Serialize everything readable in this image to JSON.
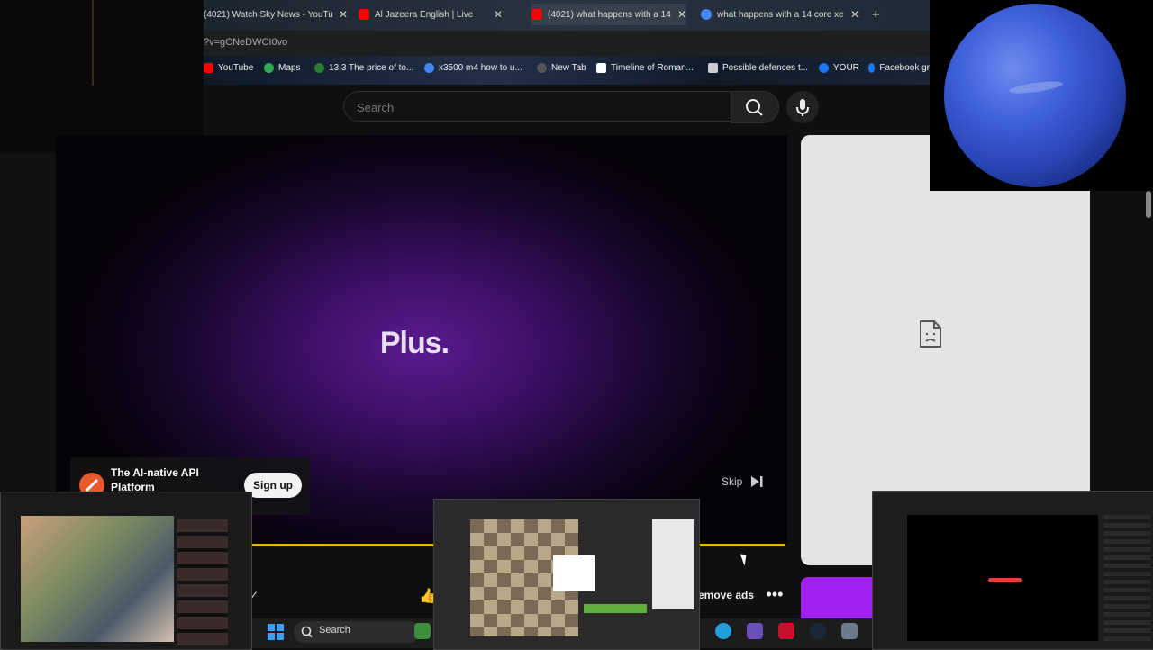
{
  "tabs": [
    {
      "label": "(4021) Watch Sky News - YouTu",
      "color": "#ff0000"
    },
    {
      "label": "Al Jazeera English | Live",
      "color": "#ff0000"
    },
    {
      "label": "(4021) what happens with a 14",
      "color": "#ff0000"
    },
    {
      "label": "what happens with a 14 core xe",
      "color": "#4285f4"
    }
  ],
  "new_tab": "+",
  "address": {
    "text": "?v=gCNeDWCI0vo"
  },
  "bookmarks": [
    {
      "label": "YouTube",
      "color": "#ff0000"
    },
    {
      "label": "Maps",
      "color": "#34a853"
    },
    {
      "label": "13.3 The price of to...",
      "color": "#2e7d32"
    },
    {
      "label": "x3500 m4 how to u...",
      "color": "#4285f4"
    },
    {
      "label": "New Tab",
      "color": "#555555"
    },
    {
      "label": "Timeline of Roman...",
      "color": "#ffffff"
    },
    {
      "label": "Possible defences t...",
      "color": "#cccccc"
    },
    {
      "label": "YOUR",
      "color": "#1877f2"
    },
    {
      "label": "Facebook gr",
      "color": "#1877f2"
    }
  ],
  "search": {
    "placeholder": "Search"
  },
  "video": {
    "title": "Plus."
  },
  "ad": {
    "text": "The AI-native API Platform",
    "signup": "Sign up",
    "skip": "Skip"
  },
  "controls": {
    "remove_ads": "emove ads",
    "more": "•••"
  },
  "taskbar": {
    "search": "Search"
  }
}
